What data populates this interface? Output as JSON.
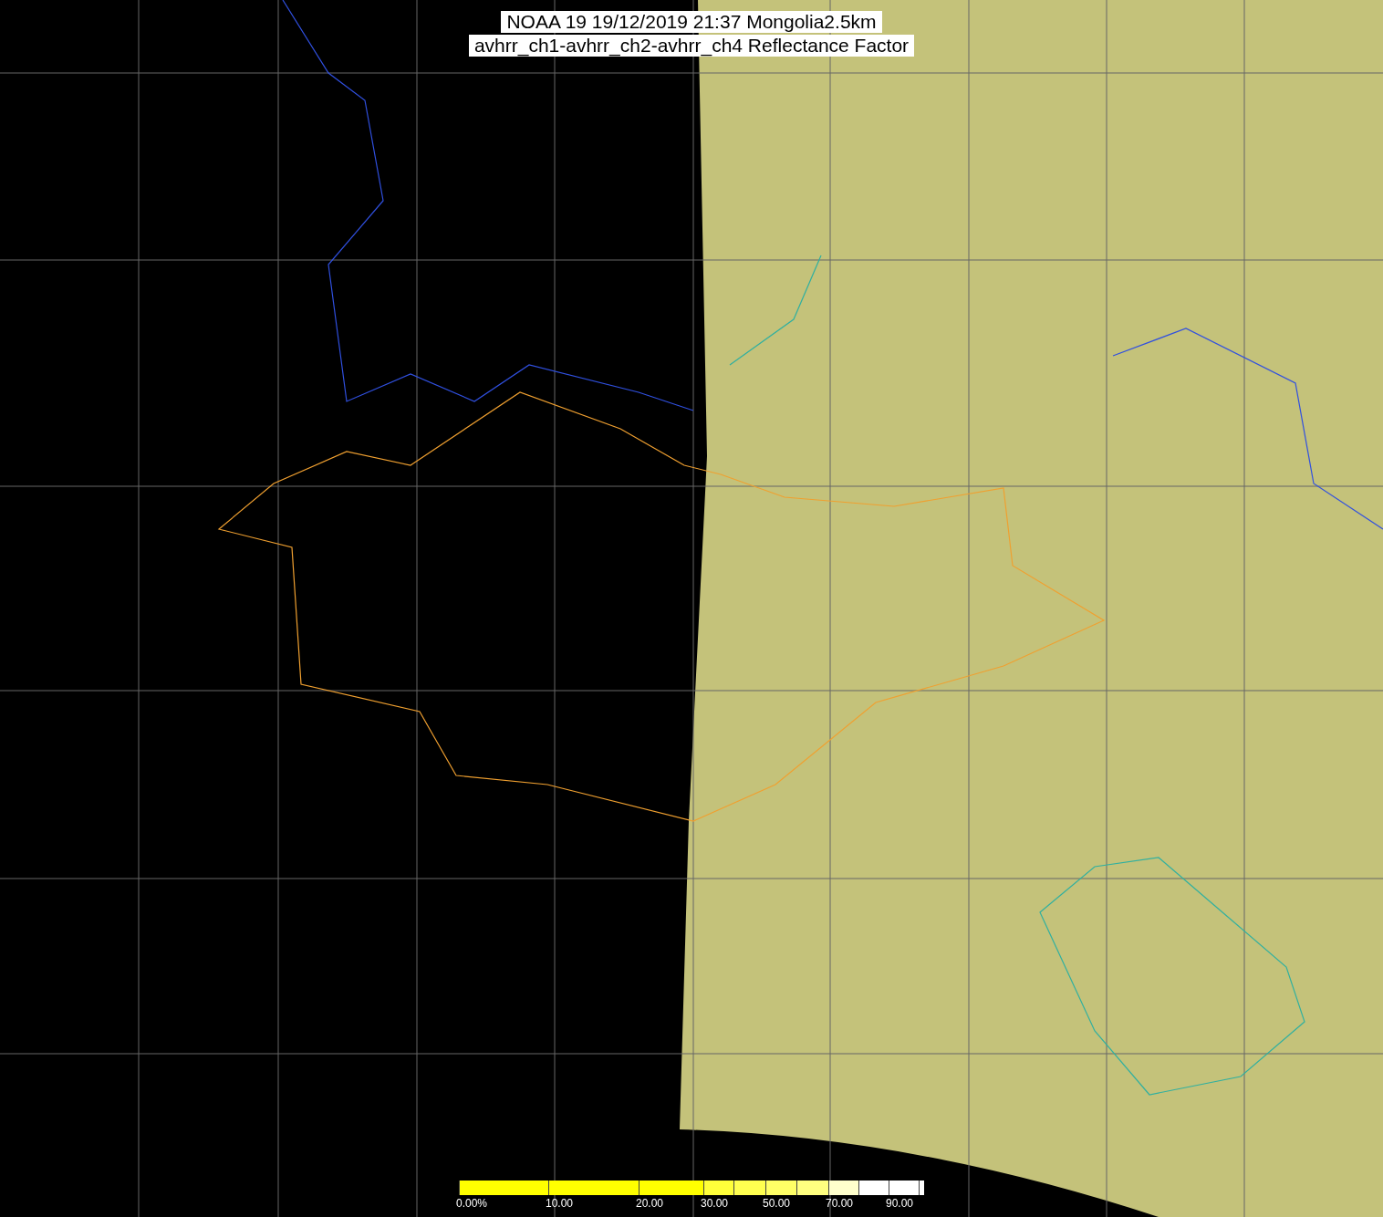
{
  "title": {
    "lines": [
      "NOAA 19 19/12/2019 21:37 Mongolia2.5km",
      "avhrr_ch1-avhrr_ch2-avhrr_ch4 Reflectance Factor"
    ]
  },
  "colorbar": {
    "segments": [
      {
        "color": "#ffff00",
        "label": "0.00%"
      },
      {
        "color": "#ffff00",
        "label": "10.00"
      },
      {
        "color": "#ffff00",
        "label": "20.00"
      },
      {
        "color": "#ffff3a",
        "label": "30.00"
      },
      {
        "color": "#ffff50"
      },
      {
        "color": "#ffff66",
        "label": "50.00"
      },
      {
        "color": "#ffff80"
      },
      {
        "color": "#ffffcc",
        "label": "70.00"
      },
      {
        "color": "#ffffff"
      },
      {
        "color": "#ffffff",
        "label": "90.00"
      },
      {
        "color": "#ffffff"
      }
    ]
  }
}
